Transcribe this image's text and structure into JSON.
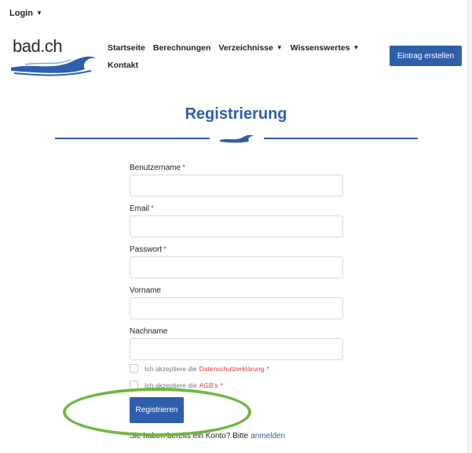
{
  "topbar": {
    "login_label": "Login",
    "login_caret_icon": "chevron-down-icon"
  },
  "logo": {
    "text": "bad.ch",
    "icon": "wave-icon"
  },
  "nav": {
    "items": [
      {
        "label": "Startseite"
      },
      {
        "label": "Berechnungen"
      },
      {
        "label": "Verzeichnisse",
        "has_dropdown": true
      },
      {
        "label": "Wissenswertes",
        "has_dropdown": true
      },
      {
        "label": "Kontakt"
      }
    ]
  },
  "cta": {
    "label": "Eintrag erstellen"
  },
  "page": {
    "title": "Registrierung",
    "divider_icon": "wave-icon"
  },
  "form": {
    "fields": [
      {
        "label": "Benutzername",
        "required": "*",
        "value": ""
      },
      {
        "label": "Email",
        "required": "*",
        "value": ""
      },
      {
        "label": "Passwort",
        "required": "*",
        "value": ""
      },
      {
        "label": "Vorname",
        "required": "",
        "value": ""
      },
      {
        "label": "Nachname",
        "required": "",
        "value": ""
      }
    ],
    "checkboxes": [
      {
        "prefix": "Ich akzeptiere die",
        "link": "Datenschutzerklärung",
        "required": "*",
        "checked": false
      },
      {
        "prefix": "Ich akzeptiere die",
        "link": "AGB's",
        "required": "*",
        "checked": false
      }
    ],
    "submit_label": "Registrieren",
    "login_hint": {
      "text": "Sie haben bereits ein Konto? Bitte",
      "link": "anmelden"
    }
  },
  "colors": {
    "brand_blue": "#2e5fad",
    "required_red": "#d63b3b",
    "annotation_green": "#6fb83f"
  }
}
